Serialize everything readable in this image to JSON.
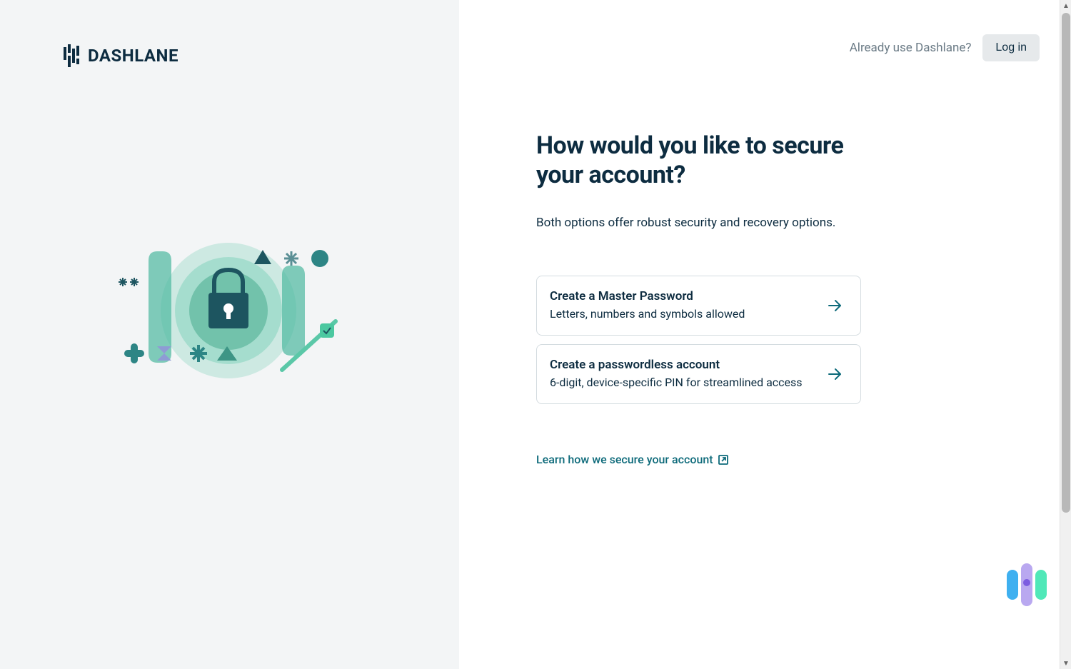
{
  "brand": {
    "name": "DASHLANE"
  },
  "header": {
    "already_text": "Already use Dashlane?",
    "login_label": "Log in"
  },
  "main": {
    "title": "How would you like to secure your account?",
    "subtitle": "Both options offer robust security and recovery options.",
    "options": [
      {
        "title": "Create a Master Password",
        "description": "Letters, numbers and symbols allowed"
      },
      {
        "title": "Create a passwordless account",
        "description": "6-digit, device-specific PIN for streamlined access"
      }
    ],
    "learn_link": "Learn how we secure your account"
  }
}
